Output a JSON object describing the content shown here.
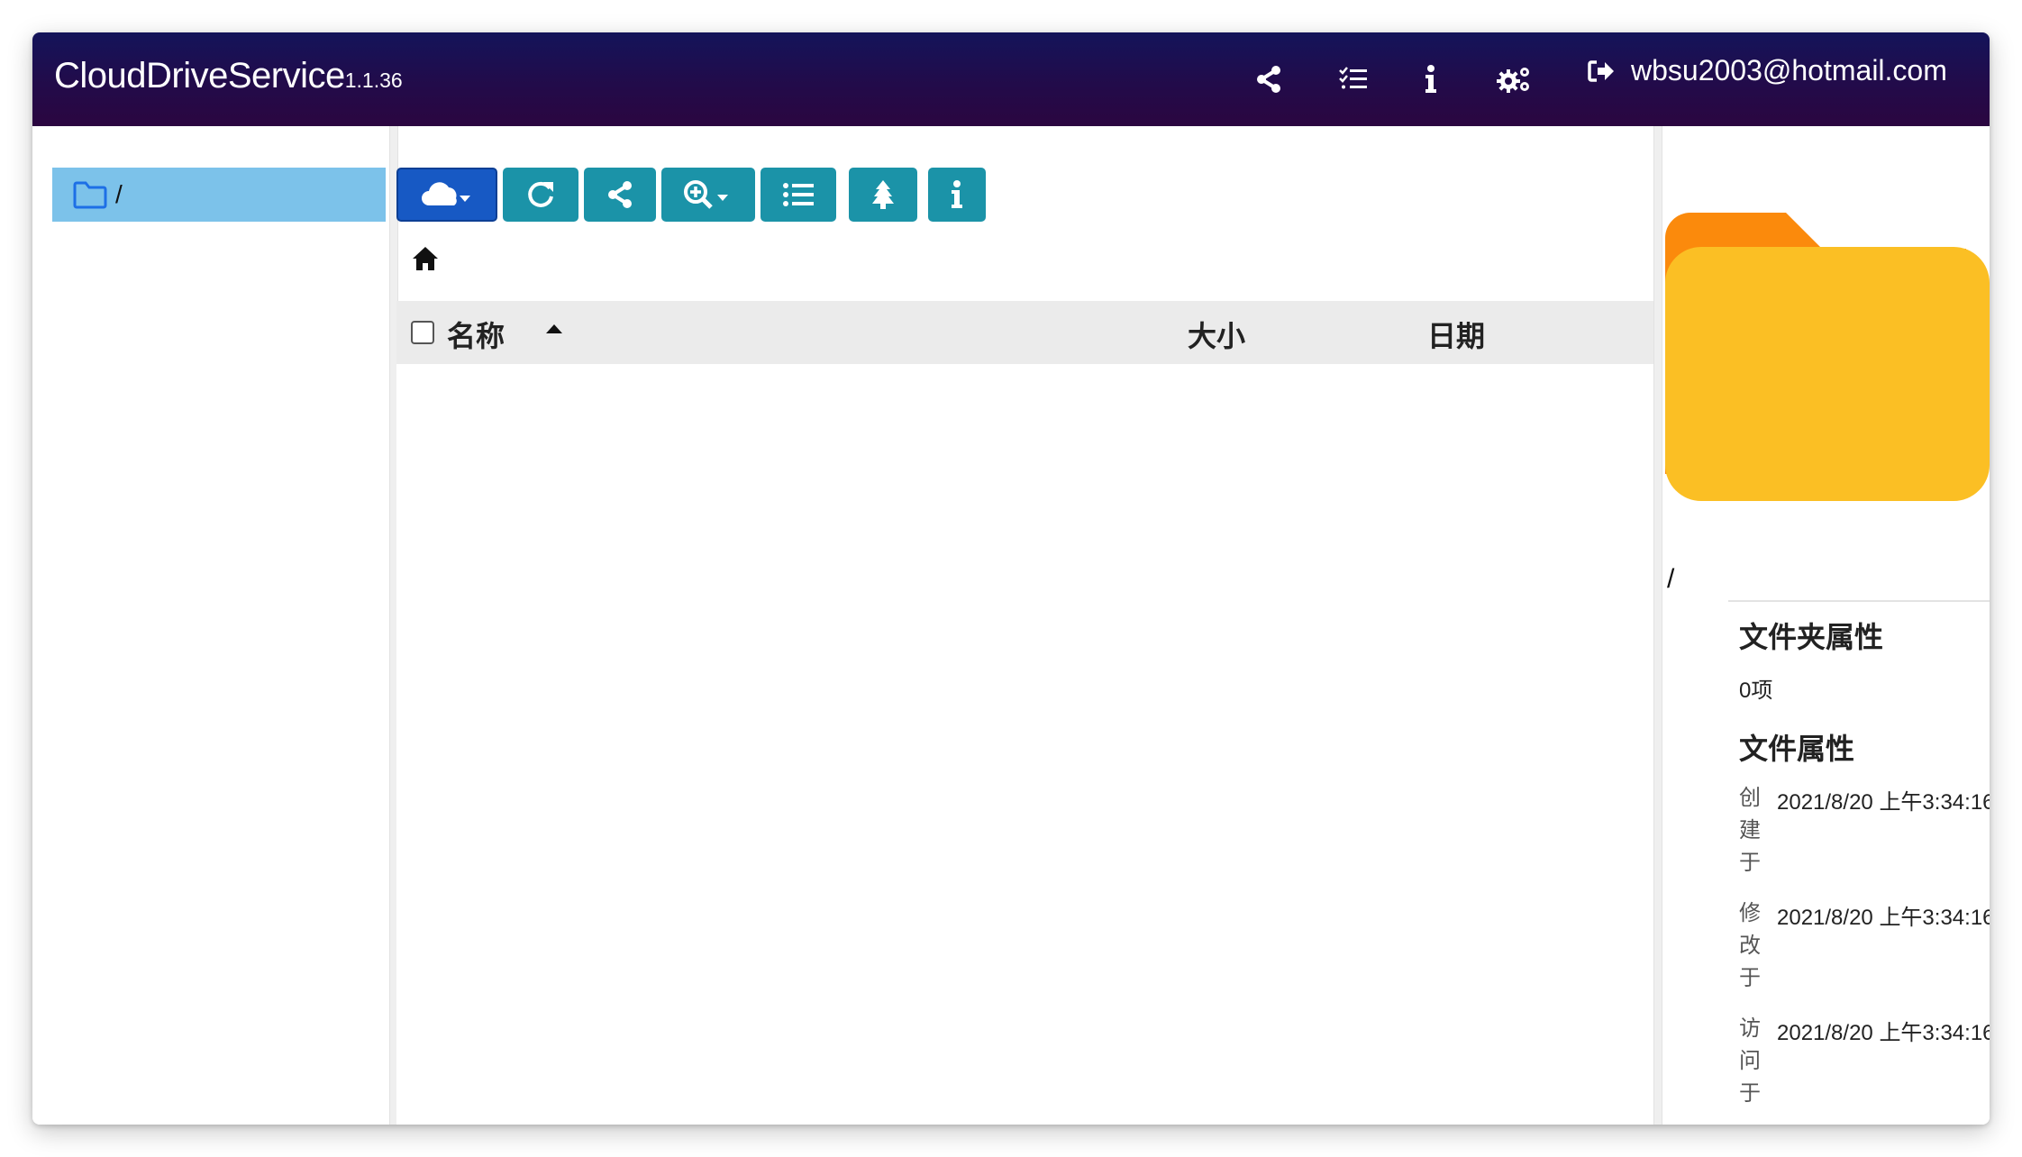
{
  "navbar": {
    "brand": "CloudDriveService",
    "version": "1.1.36",
    "icons": [
      "share-icon",
      "task-list-icon",
      "info-icon",
      "settings-gears-icon"
    ],
    "user_email": "wbsu2003@hotmail.com"
  },
  "tree": {
    "root_label": "/"
  },
  "toolbar": {
    "buttons": [
      "cloud-dropdown",
      "refresh",
      "share",
      "zoom-dropdown",
      "list-view",
      "tree",
      "info"
    ]
  },
  "table": {
    "columns": {
      "name": "名称",
      "size": "大小",
      "date": "日期"
    },
    "sort": "name-ascending",
    "rows": []
  },
  "info_panel": {
    "path": "/",
    "folder_props_title": "文件夹属性",
    "item_count": "0项",
    "file_props_title": "文件属性",
    "props": [
      {
        "label": "创建于",
        "value": "2021/8/20 上午3:34:16"
      },
      {
        "label": "修改于",
        "value": "2021/8/20 上午3:34:16"
      },
      {
        "label": "访问于",
        "value": "2021/8/20 上午3:34:16"
      }
    ]
  },
  "colors": {
    "navbar": "#1b0b4d",
    "tree_selected": "#7cc2ea",
    "toolbar_button": "#1b93a8",
    "primary_button": "#1759c4",
    "folder_front": "#fbbf24",
    "folder_back": "#fb8a0c"
  }
}
